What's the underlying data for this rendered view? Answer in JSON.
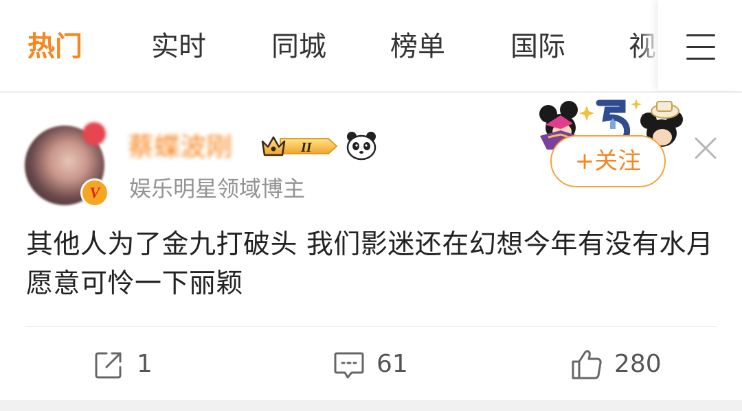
{
  "tabs": {
    "items": [
      {
        "label": "热门",
        "active": true
      },
      {
        "label": "实时",
        "active": false
      },
      {
        "label": "同城",
        "active": false
      },
      {
        "label": "榜单",
        "active": false
      },
      {
        "label": "国际",
        "active": false
      },
      {
        "label": "视",
        "active": false
      }
    ],
    "menu_icon": "hamburger-menu-icon"
  },
  "post": {
    "author": {
      "name": "蔡蝶波刚",
      "verification": "娱乐明星领域博主",
      "verified_badge": "V",
      "level_badge": "II",
      "crown_icon": "crown-icon",
      "panda_icon": "panda-icon"
    },
    "follow_label": "+关注",
    "close_icon": "close-icon",
    "decoration_icon": "disney-mickey-minnie-decoration",
    "text": "其他人为了金九打破头 我们影迷还在幻想今年有没有水月愿意可怜一下丽颖",
    "actions": {
      "repost_count": "1",
      "comment_count": "61",
      "like_count": "280"
    }
  },
  "colors": {
    "accent": "#f7861e",
    "text_primary": "#222222",
    "text_secondary": "#939393",
    "divider": "#e8e8e8",
    "verified_badge": "#f5a623"
  }
}
